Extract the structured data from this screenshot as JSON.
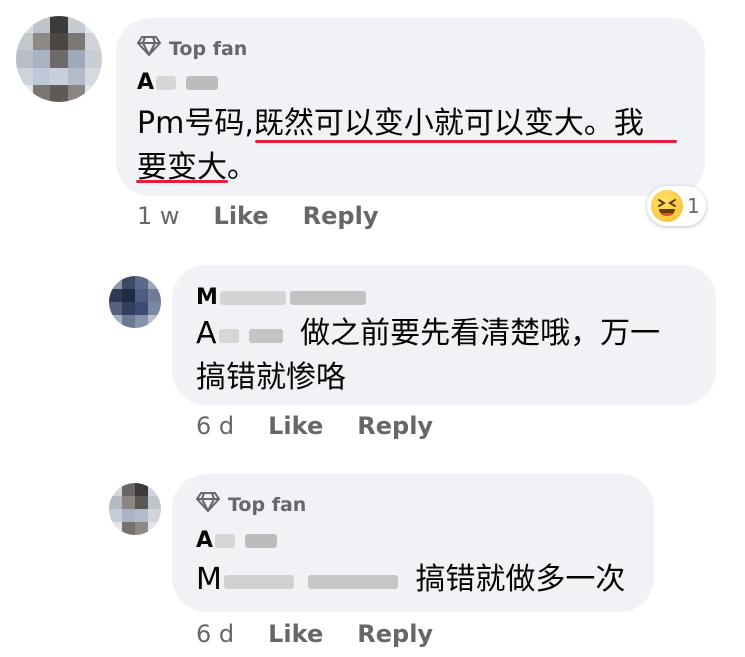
{
  "comments": [
    {
      "badge": "Top fan",
      "author_initial": "A",
      "text_line1_a": "Pm号码,",
      "text_line1_b": "既然可以变小就可以变大。我",
      "text_line2_a": "要变大",
      "text_line2_b": "。",
      "time": "1 w",
      "like_label": "Like",
      "reply_label": "Reply",
      "reaction_count": "1",
      "reaction_icon": "laughing-emoji-icon",
      "colors": {
        "underline": "#e41e3f"
      }
    },
    {
      "author_initial": "M",
      "mention_initial": "A",
      "text_line1": "做之前要先看清楚哦，万一",
      "text_line2": "搞错就惨咯",
      "time": "6 d",
      "like_label": "Like",
      "reply_label": "Reply"
    },
    {
      "badge": "Top fan",
      "author_initial": "A",
      "mention_initial": "M",
      "text_line1": "搞错就做多一次",
      "time": "6 d",
      "like_label": "Like",
      "reply_label": "Reply"
    }
  ],
  "colors": {
    "bubble": "#f0f2f5",
    "secondary_text": "#65676b",
    "badge_icon": "diamond-icon"
  }
}
